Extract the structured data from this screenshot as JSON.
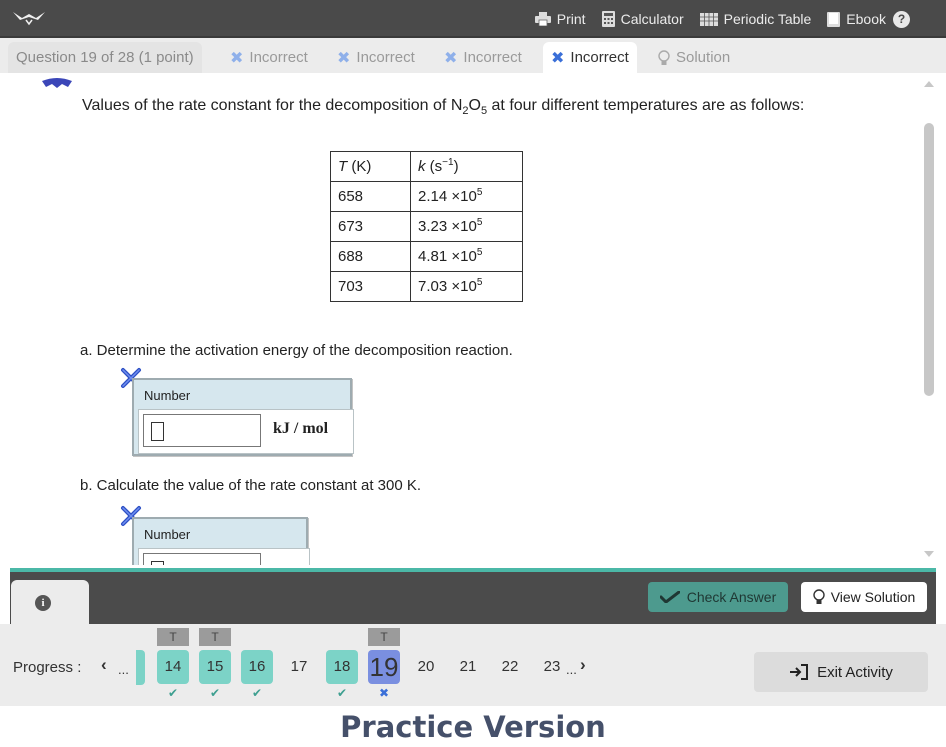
{
  "toolbar": {
    "print": "Print",
    "calculator": "Calculator",
    "periodic_table": "Periodic Table",
    "ebook": "Ebook",
    "help": "?"
  },
  "tabs": {
    "question": "Question 19 of 28 (1 point)",
    "attempts": [
      "Incorrect",
      "Incorrect",
      "Incorrect",
      "Incorrect"
    ],
    "solution": "Solution"
  },
  "question": {
    "intro_before": "Values of the rate constant for the decomposition of N",
    "sub1": "2",
    "intro_mid": "O",
    "sub2": "5",
    "intro_after": " at four different temperatures are as follows:",
    "table": {
      "col_t_var": "T",
      "col_t_unit": " (K)",
      "col_k_var": "k",
      "col_k_unit": " (s",
      "col_k_exp": "−1",
      "col_k_close": ")",
      "rows": [
        {
          "t": "658",
          "k": "2.14 ×10",
          "exp": "5"
        },
        {
          "t": "673",
          "k": "3.23 ×10",
          "exp": "5"
        },
        {
          "t": "688",
          "k": "4.81 ×10",
          "exp": "5"
        },
        {
          "t": "703",
          "k": "7.03 ×10",
          "exp": "5"
        }
      ]
    },
    "part_a": "a. Determine the activation energy of the decomposition reaction.",
    "part_a_label": "Number",
    "part_a_unit": "kJ / mol",
    "part_b": "b. Calculate the value of the rate constant at 300 K.",
    "part_b_label": "Number"
  },
  "actions": {
    "check": "Check Answer",
    "view_solution": "View Solution",
    "info": "i"
  },
  "progress": {
    "label": "Progress :",
    "ellipsis": "...",
    "items": [
      {
        "num": "14",
        "state": "done",
        "tag": "T",
        "mark": "✔"
      },
      {
        "num": "15",
        "state": "done",
        "tag": "T",
        "mark": "✔"
      },
      {
        "num": "16",
        "state": "done",
        "tag": "",
        "mark": "✔"
      },
      {
        "num": "17",
        "state": "plain",
        "tag": "",
        "mark": ""
      },
      {
        "num": "18",
        "state": "done",
        "tag": "",
        "mark": "✔"
      },
      {
        "num": "19",
        "state": "cur",
        "tag": "T",
        "mark": "✖"
      },
      {
        "num": "20",
        "state": "plain",
        "tag": "",
        "mark": ""
      },
      {
        "num": "21",
        "state": "plain",
        "tag": "",
        "mark": ""
      },
      {
        "num": "22",
        "state": "plain",
        "tag": "",
        "mark": ""
      },
      {
        "num": "23",
        "state": "plain",
        "tag": "",
        "mark": ""
      }
    ],
    "exit": "Exit Activity"
  },
  "footer": "Practice Version",
  "colors": {
    "accent": "#4bb8a7",
    "incorrect": "#3a6fd8",
    "current": "#7a8fe0"
  }
}
